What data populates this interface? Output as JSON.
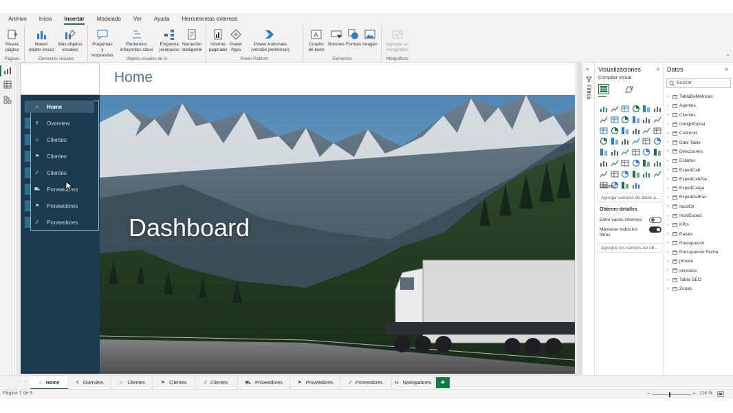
{
  "menu": [
    {
      "label": "Archivo",
      "active": false
    },
    {
      "label": "Inicio",
      "active": false
    },
    {
      "label": "Insertar",
      "active": true
    },
    {
      "label": "Modelado",
      "active": false
    },
    {
      "label": "Ver",
      "active": false
    },
    {
      "label": "Ayuda",
      "active": false
    },
    {
      "label": "Herramientas externas",
      "active": false
    }
  ],
  "ribbon": {
    "groups": [
      {
        "label": "Páginas",
        "buttons": [
          "Nueva página"
        ]
      },
      {
        "label": "Elementos visuales",
        "buttons": [
          "Nuevo objeto visual",
          "Más objetos visuales"
        ]
      },
      {
        "label": "Objetos visuales de IA",
        "buttons": [
          "Preguntas y respuestas",
          "Elementos influyentes clave",
          "Esquema jerárquico",
          "Narración inteligente"
        ]
      },
      {
        "label": "Power Platform",
        "buttons": [
          "Informe paginado",
          "Power Apps",
          "Power Automate (versión preliminar)"
        ]
      },
      {
        "label": "Elementos",
        "buttons": [
          "Cuadro de texto",
          "Botones",
          "Formas",
          "Imagen"
        ]
      },
      {
        "label": "Minigráficos",
        "buttons": [
          "Agregar un minigráfico"
        ]
      }
    ]
  },
  "canvas": {
    "page_title": "Home",
    "hero_title": "Dashboard"
  },
  "nav_buttons": [
    {
      "icon": "⌂",
      "label": "Home",
      "active": true
    },
    {
      "icon": "€",
      "label": "Overview",
      "active": false
    },
    {
      "icon": "☺",
      "label": "Clientes",
      "active": false
    },
    {
      "icon": "⚑",
      "label": "Clientes",
      "active": false
    },
    {
      "icon": "⁄⁄",
      "label": "Clientes",
      "active": false
    },
    {
      "icon": "⛟",
      "label": "Proveedores",
      "active": false
    },
    {
      "icon": "⚑",
      "label": "Proveedores",
      "active": false
    },
    {
      "icon": "⁄⁄",
      "label": "Proveedores",
      "active": false
    }
  ],
  "filters_label": "Filtros",
  "visualizations": {
    "title": "Visualizaciones",
    "build_label": "Compilar visual",
    "values_label": "Valores",
    "values_placeholder": "Agregar campos de datos a...",
    "drill_label": "Obtener detalles",
    "cross_report": "Entre varios informes",
    "cross_report_on": false,
    "keep_filters": "Mantener todos los filtros",
    "keep_filters_on": true,
    "drill_placeholder": "Agregue los campos de ob..."
  },
  "data_pane": {
    "title": "Datos",
    "search_placeholder": "Buscar",
    "tables": [
      "TablaDeMétricas",
      "Agentes",
      "Clientes",
      "codigoPostal",
      "CodIncid",
      "Date Table",
      "Direcciones",
      "Estados",
      "ExpedCab",
      "ExpedCabPar",
      "ExpedCarga",
      "ExpedDetFac",
      "IncidCli",
      "IncidExped",
      "KPIs",
      "Paises",
      "Presupuesto",
      "Presupuesto Fecha",
      "provee",
      "servicios",
      "Tabla GEO",
      "Zonas"
    ]
  },
  "tabs": [
    {
      "icon": "⌂",
      "label": "Home",
      "active": true
    },
    {
      "icon": "€",
      "label": "Overview",
      "active": false
    },
    {
      "icon": "☺",
      "label": "Clientes",
      "active": false
    },
    {
      "icon": "⚑",
      "label": "Clientes",
      "active": false
    },
    {
      "icon": "⁄⁄",
      "label": "Clientes",
      "active": false
    },
    {
      "icon": "⛟",
      "label": "Proveedores",
      "active": false
    },
    {
      "icon": "⚑",
      "label": "Proveedores",
      "active": false
    },
    {
      "icon": "⁄⁄",
      "label": "Proveedores",
      "active": false
    },
    {
      "icon": "⇆",
      "label": "Navegadores",
      "active": false
    }
  ],
  "add_tab_label": "+",
  "status": {
    "page_info": "Página 1 de 9",
    "zoom_minus": "−",
    "zoom_plus": "+",
    "zoom": "114 %",
    "zoom_fraction": 0.45
  },
  "colors": {
    "accent_green": "#107c41",
    "nav_panel": "#1c3a4f",
    "title_blue": "#4e7c93"
  }
}
